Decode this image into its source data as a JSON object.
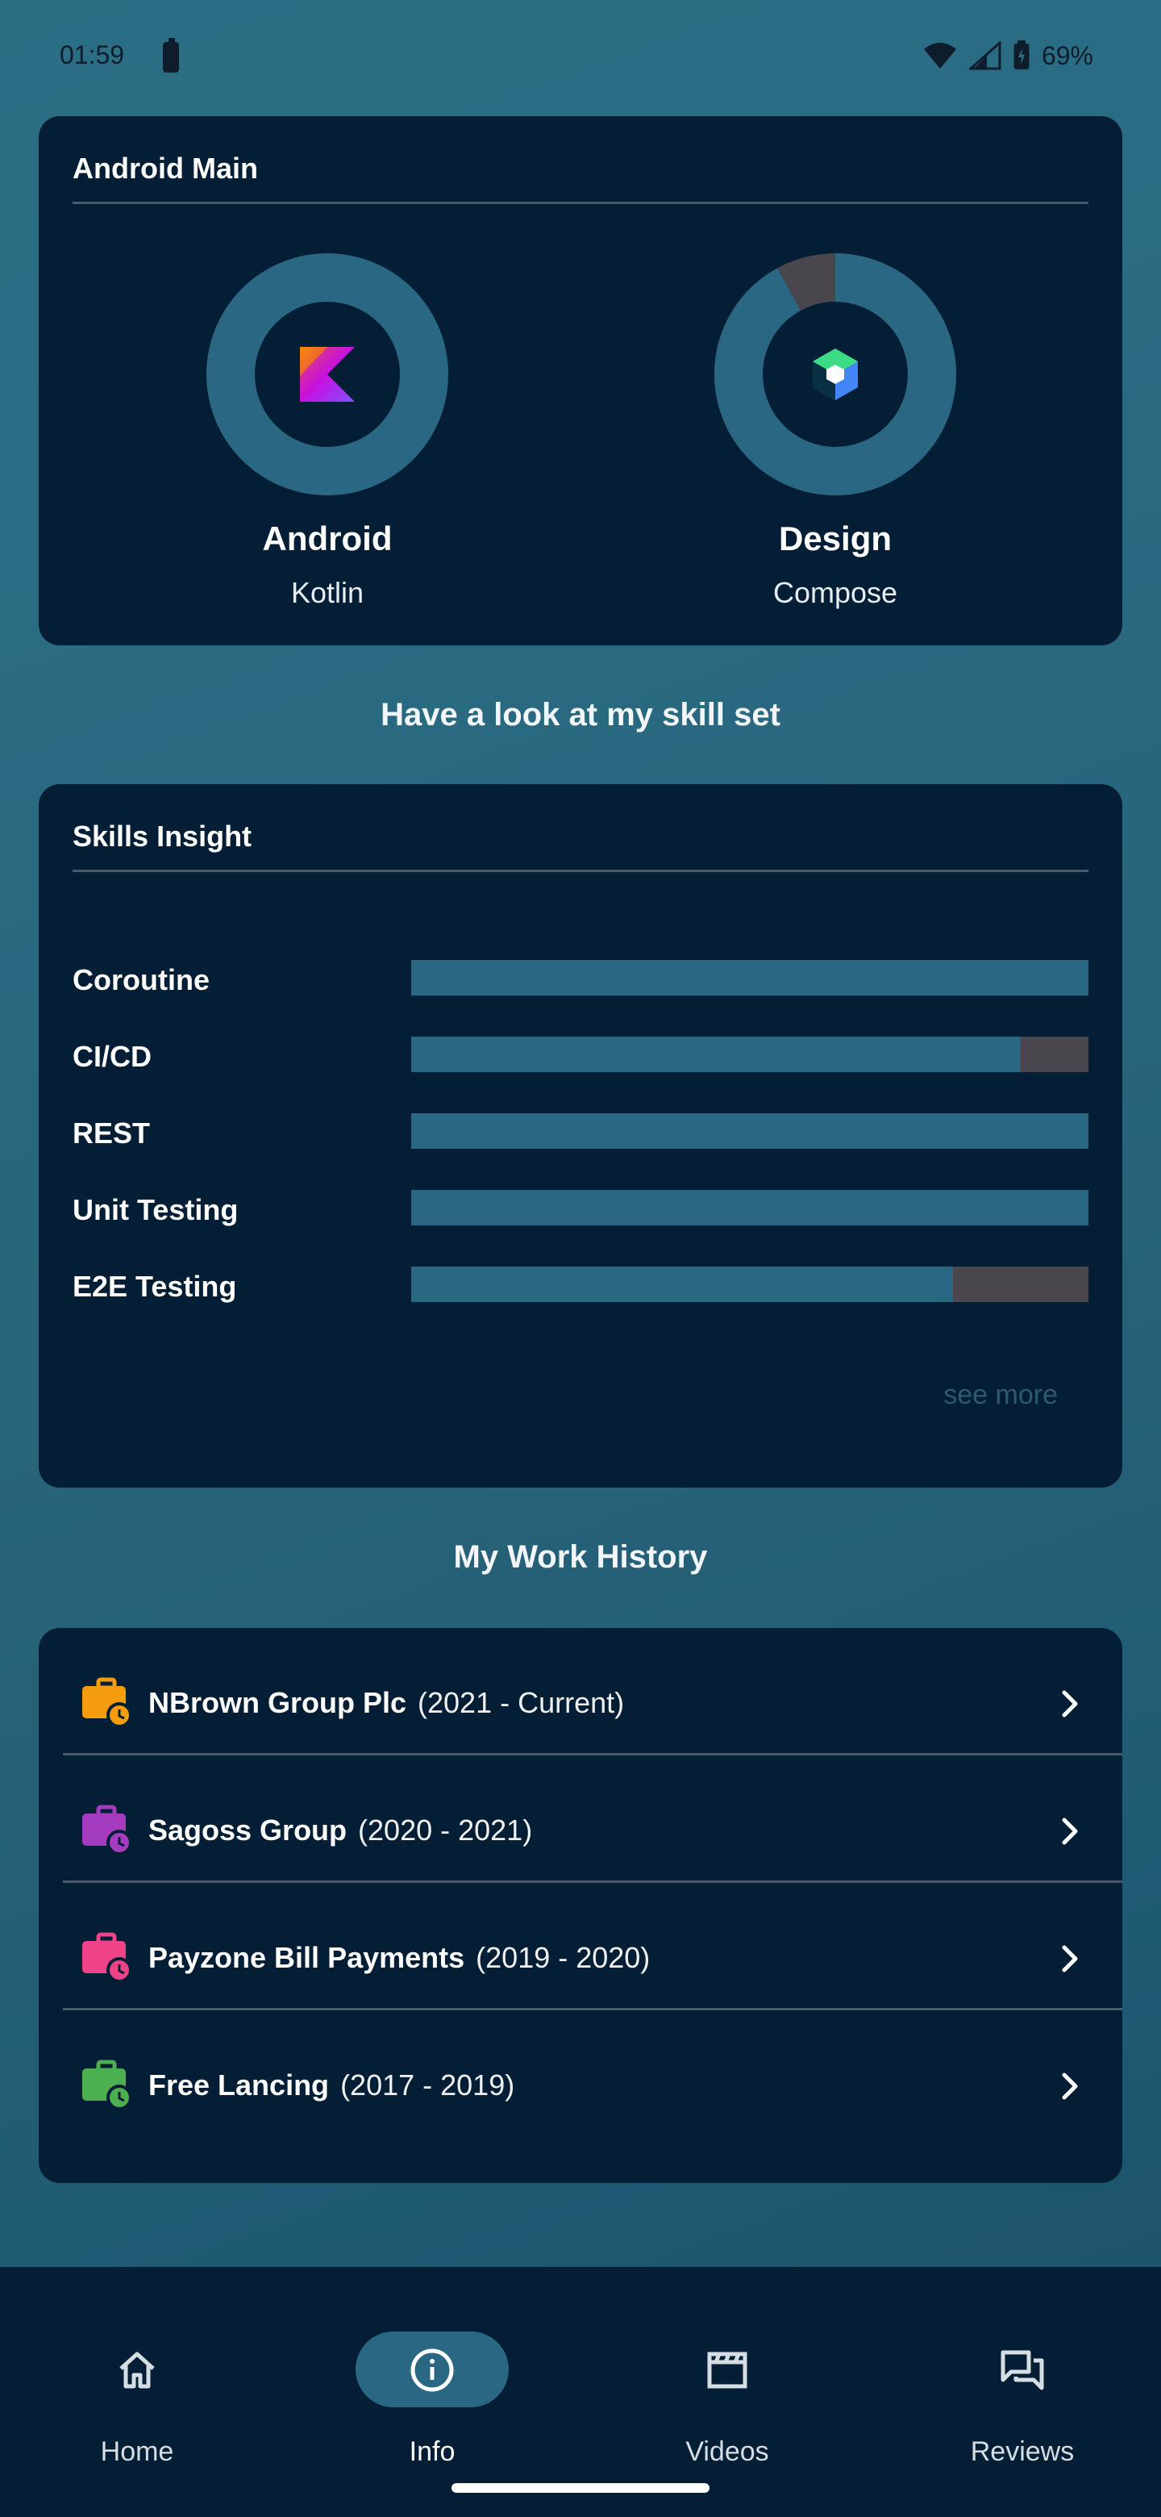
{
  "status_bar": {
    "time": "01:59",
    "battery_percent": "69%"
  },
  "android_main": {
    "title": "Android Main",
    "items": [
      {
        "label": "Android",
        "sub": "Kotlin",
        "progress": 1.0
      },
      {
        "label": "Design",
        "sub": "Compose",
        "progress": 0.92
      }
    ]
  },
  "skill_heading": "Have a look at my skill set",
  "skills_insight": {
    "title": "Skills Insight",
    "skills": [
      {
        "name": "Coroutine",
        "level": 1.0
      },
      {
        "name": "CI/CD",
        "level": 0.9
      },
      {
        "name": "REST",
        "level": 1.0
      },
      {
        "name": "Unit Testing",
        "level": 1.0
      },
      {
        "name": "E2E Testing",
        "level": 0.8
      }
    ],
    "see_more": "see more"
  },
  "work_heading": "My Work History",
  "work_history": [
    {
      "company": "NBrown Group Plc",
      "period": "(2021 - Current)",
      "color": "#f59d0f"
    },
    {
      "company": "Sagoss Group",
      "period": "(2020 - 2021)",
      "color": "#a53cc0"
    },
    {
      "company": "Payzone Bill Payments",
      "period": "(2019 - 2020)",
      "color": "#ee4387"
    },
    {
      "company": "Free Lancing",
      "period": "(2017 - 2019)",
      "color": "#4caf50"
    }
  ],
  "bottom_nav": {
    "items": [
      {
        "label": "Home",
        "icon": "home-icon"
      },
      {
        "label": "Info",
        "icon": "info-icon",
        "selected": true
      },
      {
        "label": "Videos",
        "icon": "clapperboard-icon"
      },
      {
        "label": "Reviews",
        "icon": "reviews-icon"
      }
    ]
  },
  "colors": {
    "card_bg": "#031e35",
    "accent": "#2a6782",
    "track": "#4a464d"
  }
}
